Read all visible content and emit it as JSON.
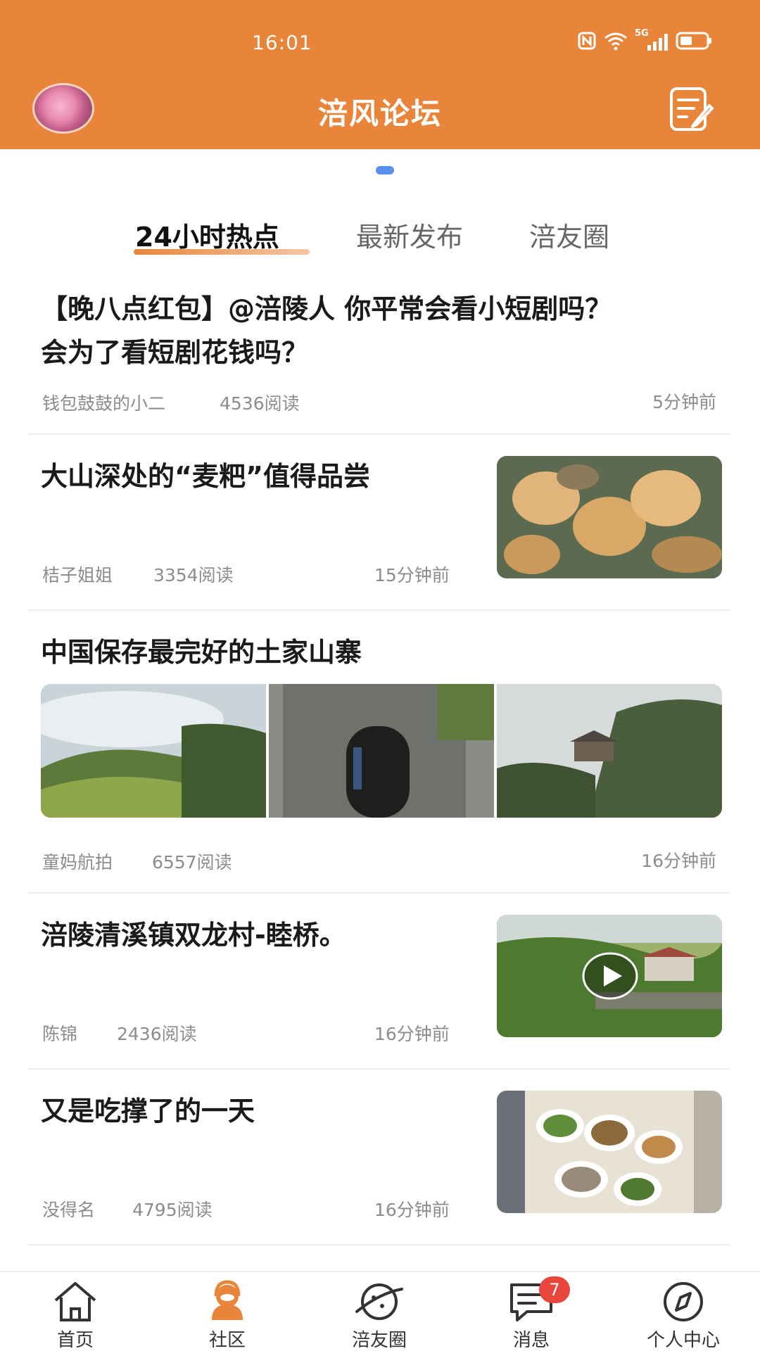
{
  "status_bar": {
    "time": "16:01",
    "network": "5G"
  },
  "header": {
    "title": "涪风论坛"
  },
  "tabs": [
    {
      "label": "24小时热点",
      "active": true
    },
    {
      "label": "最新发布",
      "active": false
    },
    {
      "label": "涪友圈",
      "active": false
    }
  ],
  "posts": [
    {
      "title_line1": "【晚八点红包】@涪陵人 你平常会看小短剧吗？",
      "title_line2": "会为了看短剧花钱吗？",
      "author": "钱包鼓鼓的小二",
      "reads": "4536阅读",
      "time": "5分钟前"
    },
    {
      "title": "大山深处的“麦粑”值得品尝",
      "author": "桔子姐姐",
      "reads": "3354阅读",
      "time": "15分钟前"
    },
    {
      "title": "中国保存最完好的土家山寨",
      "author": "童妈航拍",
      "reads": "6557阅读",
      "time": "16分钟前"
    },
    {
      "title": "涪陵清溪镇双龙村-睦桥。",
      "author": "陈锦",
      "reads": "2436阅读",
      "time": "16分钟前"
    },
    {
      "title": "又是吃撑了的一天",
      "author": "没得名",
      "reads": "4795阅读",
      "time": "16分钟前"
    }
  ],
  "bottom_nav": [
    {
      "label": "首页",
      "icon": "home-icon"
    },
    {
      "label": "社区",
      "icon": "community-icon",
      "active": true
    },
    {
      "label": "涪友圈",
      "icon": "planet-icon"
    },
    {
      "label": "消息",
      "icon": "message-icon",
      "badge": "7"
    },
    {
      "label": "个人中心",
      "icon": "compass-icon"
    }
  ],
  "colors": {
    "brand": "#E9853A",
    "accent_blue": "#5B8FEF",
    "badge": "#E8463C"
  }
}
